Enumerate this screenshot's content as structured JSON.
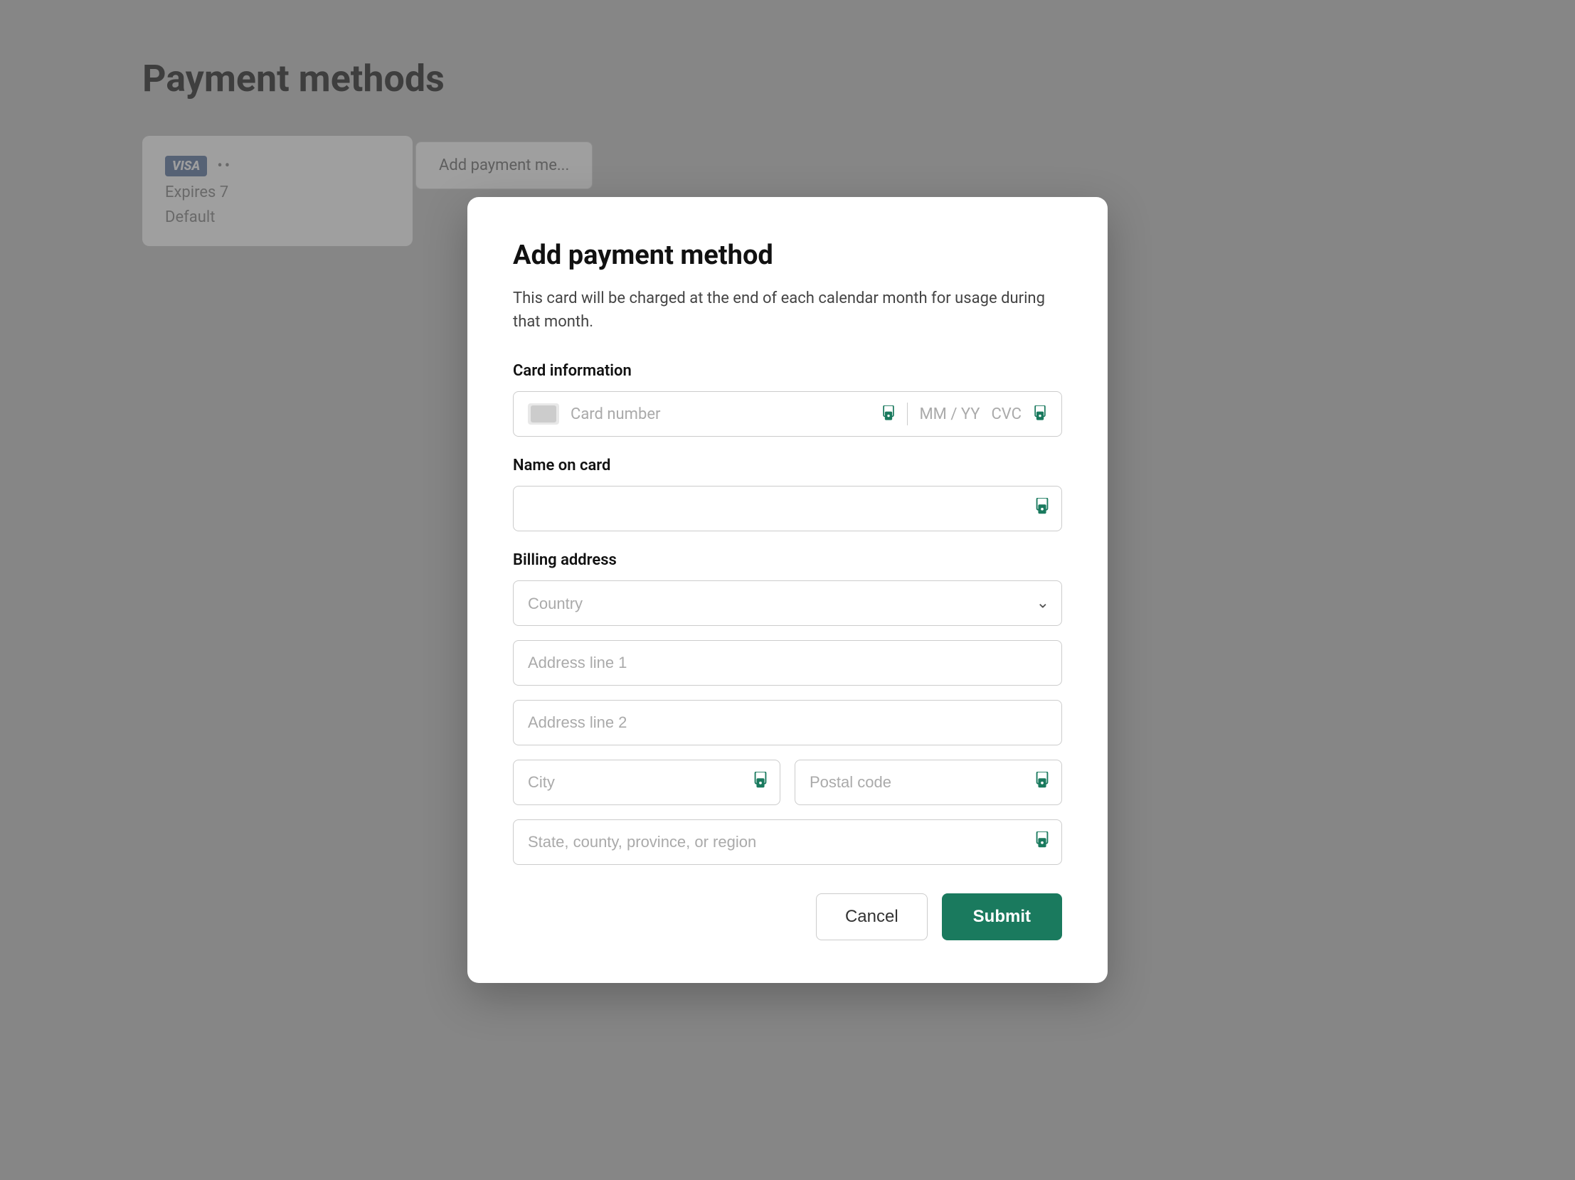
{
  "page": {
    "title": "Payment methods",
    "background_color": "#b0b0b0"
  },
  "existing_card": {
    "brand": "VISA",
    "dots": "••",
    "expires_label": "Expires",
    "expires_value": "7",
    "default_label": "Default"
  },
  "add_button_label": "Add payment me...",
  "modal": {
    "title": "Add payment method",
    "description": "This card will be charged at the end of each calendar month for usage during that month.",
    "card_info_label": "Card information",
    "card_number_placeholder": "Card number",
    "expiry_placeholder": "MM / YY",
    "cvc_placeholder": "CVC",
    "name_label": "Name on card",
    "name_placeholder": "",
    "billing_label": "Billing address",
    "country_placeholder": "Country",
    "address1_placeholder": "Address line 1",
    "address2_placeholder": "Address line 2",
    "city_placeholder": "City",
    "postal_placeholder": "Postal code",
    "state_placeholder": "State, county, province, or region",
    "cancel_label": "Cancel",
    "submit_label": "Submit",
    "accent_color": "#1a7a5e"
  }
}
